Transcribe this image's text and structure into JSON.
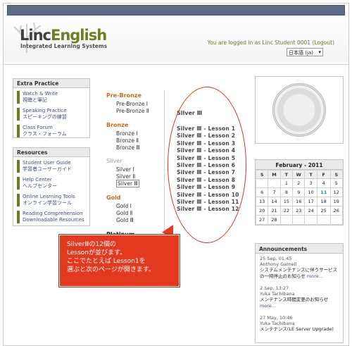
{
  "header": {
    "logo_linc": "Linc",
    "logo_english": "English",
    "tagline": "Integrated Learning Systems",
    "login_prefix": "You are logged in as",
    "user": "Linc Student 0001",
    "logout": "(Logout)",
    "language": "日本語 (ja)"
  },
  "extra_practice": {
    "title": "Extra Practice",
    "items": [
      {
        "en": "Watch & Write",
        "jp": "視聴と筆記"
      },
      {
        "en": "Speaking Practice",
        "jp": "スピーキングの練習"
      },
      {
        "en": "Class Forum",
        "jp": "クラス・フォーラム"
      }
    ]
  },
  "resources": {
    "title": "Resources",
    "items": [
      {
        "en": "Student User Guide",
        "jp": "学習者ユーザーガイド"
      },
      {
        "en": "Help Center",
        "jp": "ヘルプセンター"
      },
      {
        "en": "Online Learning Tools",
        "jp": "オンライン学習ツール"
      },
      {
        "en": "Reading Comprehension",
        "jp": "Downloadable Resources"
      }
    ]
  },
  "levels": {
    "pre_bronze": {
      "title": "Pre-Bronze",
      "items": [
        "Pre-Bronze Ⅰ",
        "Pre-Bronze Ⅱ"
      ]
    },
    "bronze": {
      "title": "Bronze",
      "items": [
        "Bronze Ⅰ",
        "Bronze Ⅱ",
        "Bronze Ⅲ"
      ]
    },
    "silver": {
      "title": "Silver",
      "items": [
        "Silver Ⅰ",
        "Silver Ⅱ",
        "Silver Ⅲ"
      ]
    },
    "gold": {
      "title": "Gold",
      "items": [
        "Gold Ⅰ",
        "Gold Ⅱ",
        "Gold Ⅲ"
      ]
    },
    "platinum": {
      "title": "Platinum"
    }
  },
  "lessons": {
    "title": "Silver Ⅲ",
    "items": [
      "Silver Ⅲ - Lesson 1",
      "Silver Ⅲ - Lesson 2",
      "Silver Ⅲ - Lesson 3",
      "Silver Ⅲ - Lesson 4",
      "Silver Ⅲ - Lesson 5",
      "Silver Ⅲ - Lesson 6",
      "Silver Ⅲ - Lesson 7",
      "Silver Ⅲ - Lesson 8",
      "Silver Ⅲ - Lesson 9",
      "Silver Ⅲ - Lesson 10",
      "Silver Ⅲ - Lesson 11",
      "Silver Ⅲ - Lesson 12"
    ]
  },
  "calendar": {
    "title": "February - 2011",
    "days": [
      "S",
      "M",
      "T",
      "W",
      "T",
      "F",
      "S"
    ],
    "weeks": [
      [
        "",
        "",
        "1",
        "2",
        "3",
        "4",
        "5"
      ],
      [
        "6",
        "7",
        "8",
        "9",
        "10",
        "11",
        "12"
      ],
      [
        "13",
        "14",
        "15",
        "16",
        "17",
        "18",
        "19"
      ],
      [
        "20",
        "21",
        "22",
        "23",
        "24",
        "25",
        "26"
      ],
      [
        "27",
        "28",
        "",
        "",
        "",
        "",
        ""
      ]
    ],
    "today": "11"
  },
  "announcements": {
    "title": "Announcements",
    "items": [
      {
        "date": "25 Sep, 01:45",
        "author": "Anthony Gamell",
        "text": "システムメンテナンスに伴うサービスの一時停止のお知らせ",
        "more": "more..."
      },
      {
        "date": "2 Sep, 13:27",
        "author": "Yuka Tachibana",
        "text": "メンテナンス時間変更のお知らせ",
        "more": "more..."
      },
      {
        "date": "27 May, 10:46",
        "author": "Yuka Tachibana",
        "text": "メンテナンス(LE Server Upgrade)",
        "more": ""
      }
    ]
  },
  "callout": {
    "lines": [
      "SilverⅢの12個の",
      "Lessonが並びます。",
      "ここでたとえば Lesson1を",
      "選ぶと次のページが開きます。"
    ]
  },
  "colors": {
    "accent_green": "#6c7b1d",
    "level_orange": "#c66a17",
    "callout_red": "#e3391f",
    "topbar": "#5e6a83"
  }
}
